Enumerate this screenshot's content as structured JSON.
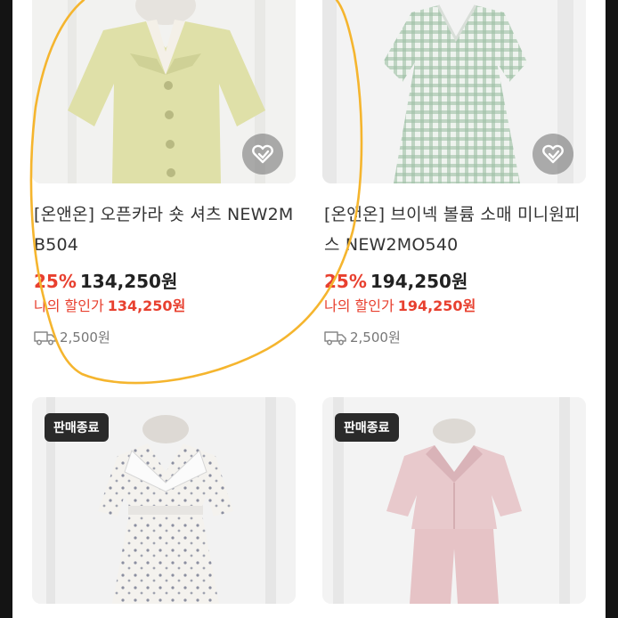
{
  "products": [
    {
      "title": "[온앤온] 오픈카라 숏 셔츠 NEW2MB504",
      "discount": "25%",
      "price": "134,250원",
      "my_price_label": "나의 할인가",
      "my_price": "134,250원",
      "shipping": "2,500원",
      "wish_icon": "heart-icon"
    },
    {
      "title": "[온앤온] 브이넥 볼륨 소매 미니원피스 NEW2MO540",
      "discount": "25%",
      "price": "194,250원",
      "my_price_label": "나의 할인가",
      "my_price": "194,250원",
      "shipping": "2,500원",
      "wish_icon": "heart-icon"
    },
    {
      "badge": "판매종료"
    },
    {
      "badge": "판매종료"
    }
  ],
  "colors": {
    "discount": "#e8402f",
    "highlight": "#f5b52e",
    "badge_bg": "#2a2a2a"
  }
}
